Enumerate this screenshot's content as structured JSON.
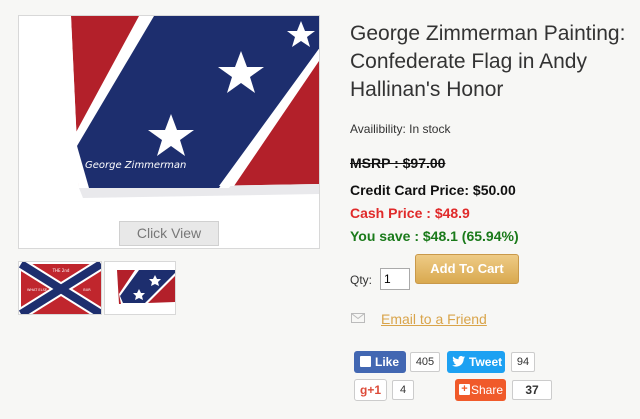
{
  "product": {
    "title": "George Zimmerman Painting: Confederate Flag in Andy Hallinan's Honor",
    "availability": "Availibility: In stock",
    "msrp": "MSRP : $97.00",
    "credit_card_price": "Credit Card Price: $50.00",
    "cash_price": "Cash Price : $48.9",
    "you_save": "You save : $48.1 (65.94%)",
    "image_signature": "George Zimmerman",
    "click_view_label": "Click View",
    "thumb1_text": {
      "top": "THE 2nd",
      "left": "WHAT ELSE",
      "right": "BUR"
    }
  },
  "purchase": {
    "qty_label": "Qty:",
    "qty_value": "1",
    "add_to_cart_label": "Add To Cart",
    "email_friend_label": "Email to a Friend"
  },
  "social": {
    "like_label": "Like",
    "like_count": "405",
    "tweet_label": "Tweet",
    "tweet_count": "94",
    "gplus_label": "g+1",
    "gplus_count": "4",
    "share_label": "Share",
    "share_count": "37"
  },
  "colors": {
    "flag_red": "#b3202a",
    "flag_blue": "#1d2e6e",
    "cash_price": "#e02a2a",
    "you_save": "#1a7a1a",
    "add_to_cart": "#d9a94f",
    "email_link": "#d9a44a",
    "facebook": "#4267b2",
    "twitter": "#1da1f2",
    "share": "#f05a2a"
  }
}
